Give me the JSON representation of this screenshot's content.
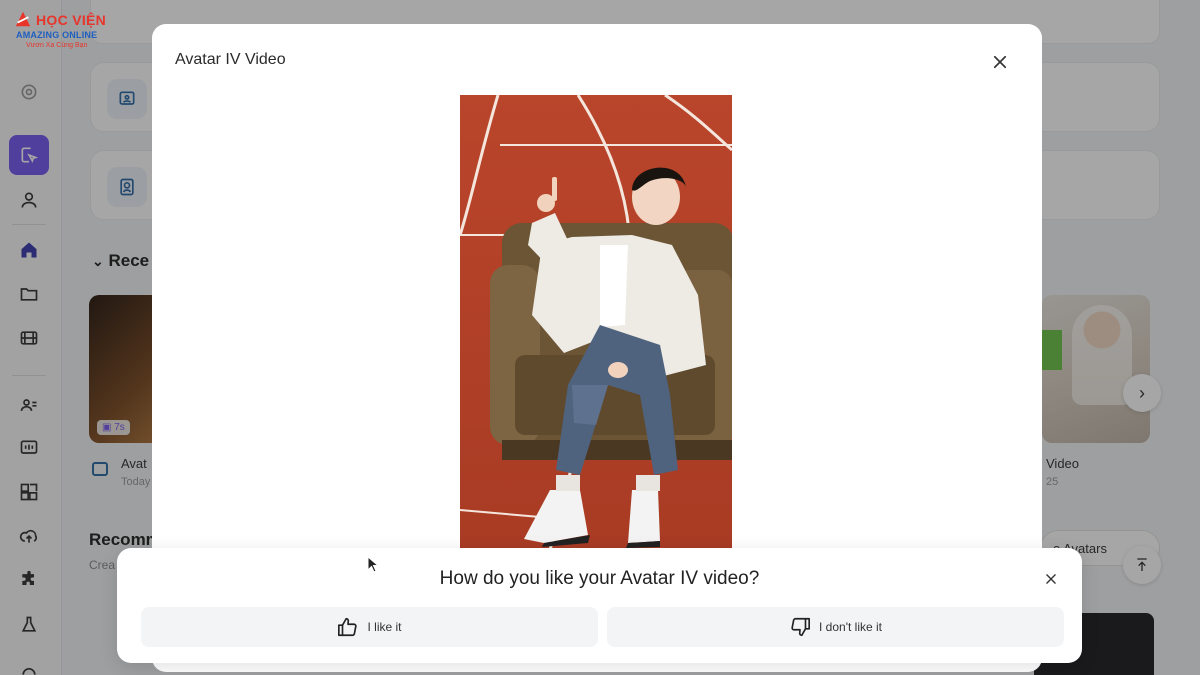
{
  "logo": {
    "title": "HỌC VIỆN",
    "line1": "AMAZING ONLINE",
    "line2": "Vươn Xa Cùng Bạn"
  },
  "background": {
    "recent_section": "Rece",
    "recommended_section": "Recomm",
    "recommended_sub": "Crea",
    "left_video_badge": "7s",
    "left_video_title": "Avat",
    "left_video_date": "Today",
    "right_video_title": "Video",
    "right_video_date": "25",
    "avatars_pill": "e Avatars"
  },
  "modal": {
    "title": "Avatar IV Video"
  },
  "feedback": {
    "question": "How do you like your Avatar IV video?",
    "like_label": "I like it",
    "dislike_label": "I don't like it"
  },
  "colors": {
    "accent": "#7559f0",
    "track": "#b8452a",
    "overlay": "rgba(20,20,20,0.38)"
  }
}
